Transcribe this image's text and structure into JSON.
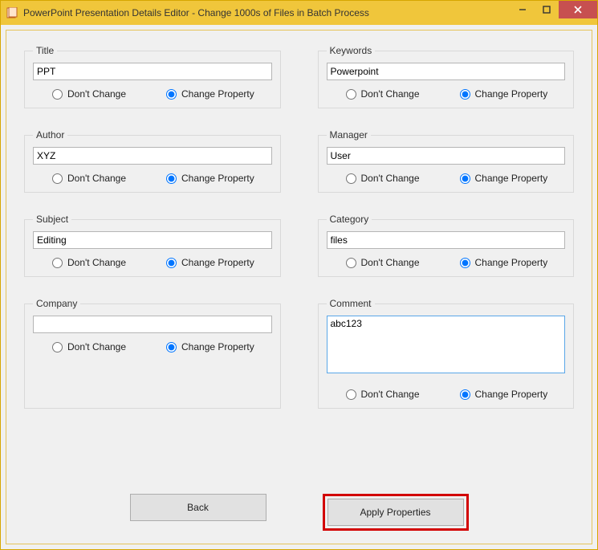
{
  "window": {
    "title": "PowerPoint Presentation Details Editor - Change 1000s of Files in Batch Process"
  },
  "labels": {
    "dont_change": "Don't Change",
    "change_property": "Change Property"
  },
  "fields": {
    "title": {
      "legend": "Title",
      "value": "PPT",
      "selected": "change"
    },
    "keywords": {
      "legend": "Keywords",
      "value": "Powerpoint",
      "selected": "change"
    },
    "author": {
      "legend": "Author",
      "value": "XYZ",
      "selected": "change"
    },
    "manager": {
      "legend": "Manager",
      "value": "User",
      "selected": "change"
    },
    "subject": {
      "legend": "Subject",
      "value": "Editing",
      "selected": "change"
    },
    "category": {
      "legend": "Category",
      "value": "files",
      "selected": "change"
    },
    "company": {
      "legend": "Company",
      "value": "",
      "selected": "change"
    },
    "comment": {
      "legend": "Comment",
      "value": "abc123",
      "selected": "change"
    }
  },
  "buttons": {
    "back": "Back",
    "apply": "Apply Properties"
  }
}
